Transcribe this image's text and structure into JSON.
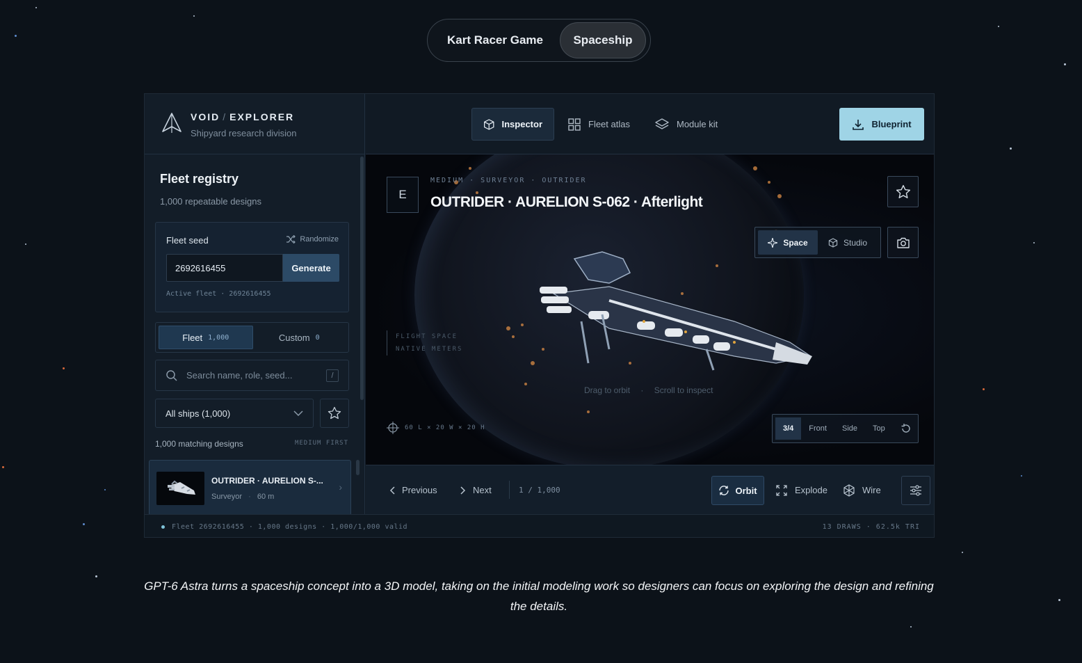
{
  "mode_toggle": {
    "options": [
      "Kart Racer Game",
      "Spaceship"
    ],
    "selected": "Spaceship"
  },
  "brand": {
    "name": "VOID",
    "section": "EXPLORER",
    "subtitle": "Shipyard research division"
  },
  "nav": {
    "tabs": [
      {
        "label": "Inspector",
        "icon": "cube-icon",
        "active": true
      },
      {
        "label": "Fleet atlas",
        "icon": "grid-icon",
        "active": false
      },
      {
        "label": "Module kit",
        "icon": "layers-icon",
        "active": false
      }
    ],
    "blueprint_label": "Blueprint"
  },
  "sidebar": {
    "title": "Fleet registry",
    "subtitle": "1,000 repeatable designs",
    "seed": {
      "label": "Fleet seed",
      "randomize_label": "Randomize",
      "value": "2692616455",
      "generate_label": "Generate",
      "active_text": "Active fleet · 2692616455"
    },
    "segments": [
      {
        "label": "Fleet",
        "count": "1,000",
        "active": true
      },
      {
        "label": "Custom",
        "count": "0",
        "active": false
      }
    ],
    "search_placeholder": "Search name, role, seed...",
    "search_shortcut": "/",
    "filter_value": "All ships (1,000)",
    "matches": "1,000 matching designs",
    "sort": "MEDIUM FIRST",
    "ship": {
      "name": "OUTRIDER · AURELION S-...",
      "role": "Surveyor",
      "length": "60 m"
    }
  },
  "viewport": {
    "badge": "E",
    "tag": "MEDIUM · SURVEYOR · OUTRIDER",
    "title": "OUTRIDER · AURELION S-062 · Afterlight",
    "env": [
      {
        "label": "Space",
        "active": true
      },
      {
        "label": "Studio",
        "active": false
      }
    ],
    "space_label_1": "FLIGHT SPACE",
    "space_label_2": "NATIVE METERS",
    "hint_1": "Drag to orbit",
    "hint_2": "Scroll to inspect",
    "dims": "60 L × 20 W × 20 H",
    "views": [
      "3/4",
      "Front",
      "Side",
      "Top"
    ],
    "active_view": "3/4"
  },
  "bottom": {
    "previous": "Previous",
    "next": "Next",
    "position": "1 / 1,000",
    "orbit": "Orbit",
    "explode": "Explode",
    "wire": "Wire"
  },
  "status": {
    "left": "Fleet 2692616455 · 1,000 designs · 1,000/1,000 valid",
    "right": "13 DRAWS · 62.5k TRI"
  },
  "caption": "GPT-6 Astra turns a spaceship concept into a 3D model, taking on the initial modeling work so designers can focus on exploring the design and refining the details.",
  "colors": {
    "accent": "#9fd4e6",
    "background": "#0c1219",
    "panel": "#131d28"
  }
}
